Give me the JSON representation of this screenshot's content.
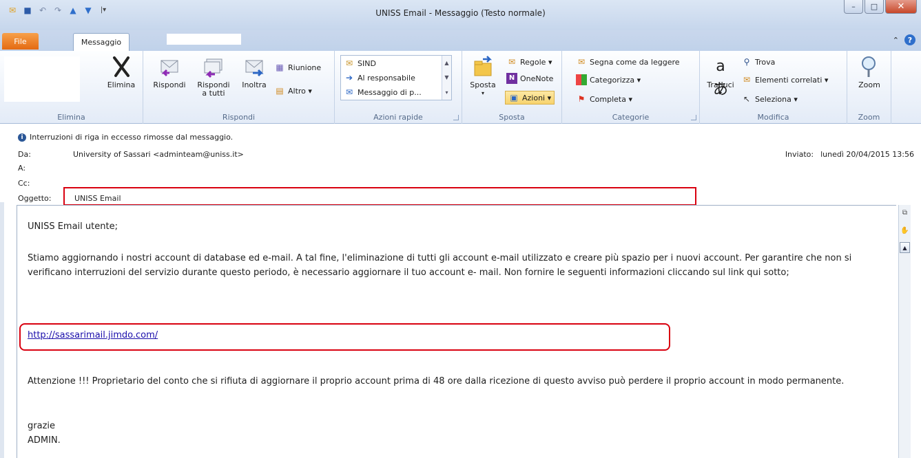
{
  "window": {
    "title": "UNISS Email  -  Messaggio (Testo normale)"
  },
  "tabs": {
    "file": "File",
    "message": "Messaggio"
  },
  "ribbon": {
    "elimina": {
      "delete": "Elimina",
      "group": "Elimina"
    },
    "rispondi": {
      "reply": "Rispondi",
      "reply_all_1": "Rispondi",
      "reply_all_2": "a tutti",
      "forward": "Inoltra",
      "meeting": "Riunione",
      "other": "Altro ▾",
      "group": "Rispondi"
    },
    "azioni_rapide": {
      "items": [
        "SIND",
        "Al responsabile",
        "Messaggio di p..."
      ],
      "group": "Azioni rapide"
    },
    "sposta": {
      "move": "Sposta",
      "rules": "Regole ▾",
      "onenote": "OneNote",
      "actions": "Azioni ▾",
      "group": "Sposta"
    },
    "categorie": {
      "mark_read": "Segna come da leggere",
      "categorize": "Categorizza ▾",
      "followup": "Completa ▾",
      "group": "Categorie"
    },
    "modifica": {
      "translate": "Traduci",
      "find": "Trova",
      "related": "Elementi correlati ▾",
      "select": "Seleziona ▾",
      "group": "Modifica"
    },
    "zoom": {
      "zoom": "Zoom",
      "group": "Zoom"
    }
  },
  "header": {
    "info": "Interruzioni di riga in eccesso rimosse dal messaggio.",
    "from_label": "Da:",
    "from_value": "University of Sassari <adminteam@uniss.it>",
    "to_label": "A:",
    "cc_label": "Cc:",
    "subject_label": "Oggetto:",
    "subject_value": "UNISS Email",
    "sent_label": "Inviato:",
    "sent_value": "lunedì 20/04/2015 13:56"
  },
  "body": {
    "greeting": "UNISS Email utente;",
    "paragraph1": "Stiamo aggiornando i nostri account di database ed e-mail. A tal fine, l'eliminazione di tutti gli account e-mail utilizzato e creare più spazio per i nuovi account. Per garantire che non si verificano interruzioni del servizio durante questo periodo, è necessario aggiornare il tuo account e- mail. Non fornire le seguenti informazioni cliccando sul link qui sotto;",
    "link": "http://sassarimail.jimdo.com/",
    "paragraph2": "Attenzione !!! Proprietario del conto che si rifiuta di aggiornare il proprio account prima di 48 ore dalla ricezione di questo avviso può perdere il proprio account in modo permanente.",
    "closing1": "grazie",
    "closing2": "ADMIN."
  },
  "colors": {
    "highlight_box": "#d9000f",
    "file_tab": "#e46a12",
    "link": "#1a0dab"
  }
}
